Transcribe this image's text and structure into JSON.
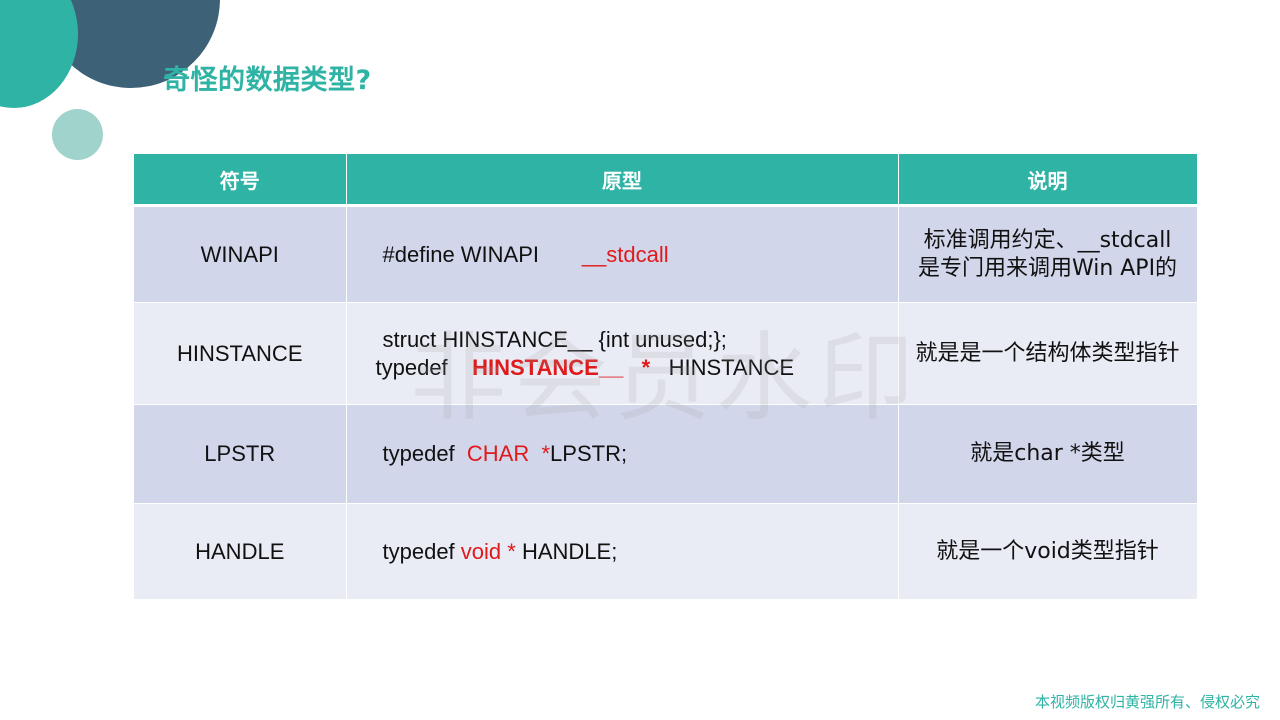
{
  "slide": {
    "title": "奇怪的数据类型?",
    "watermark": "非会员水印",
    "footer": "本视频版权归黄强所有、侵权必究"
  },
  "table": {
    "headers": [
      "符号",
      "原型",
      "说明"
    ],
    "rows": [
      {
        "symbol": "WINAPI",
        "proto": {
          "a": "#define WINAPI",
          "b": "__stdcall"
        },
        "desc": "标准调用约定、__stdcall是专门用来调用Win API的"
      },
      {
        "symbol": "HINSTANCE",
        "proto": {
          "line1": "struct  HINSTANCE__ {int unused;};",
          "l2a": "typedef",
          "l2b": "HINSTANCE__",
          "l2c": "*",
          "l2d": "HINSTANCE"
        },
        "desc": "就是是一个结构体类型指针"
      },
      {
        "symbol": "LPSTR",
        "proto": {
          "a": "typedef",
          "b": "CHAR",
          "c": "*",
          "d": "LPSTR;"
        },
        "desc": "就是char  *类型"
      },
      {
        "symbol": "HANDLE",
        "proto": {
          "a": "typedef",
          "b": "void",
          "c": "*",
          "d": "HANDLE;"
        },
        "desc": "就是一个void类型指针"
      }
    ]
  },
  "colors": {
    "accent": "#2fb3a4",
    "dark": "#3d6278",
    "row_dark": "#d1d6ea",
    "row_light": "#e9ebf5",
    "code_red": "#e0191b"
  }
}
